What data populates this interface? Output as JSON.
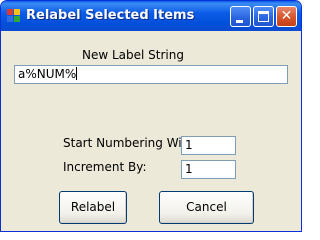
{
  "window": {
    "title": "Relabel Selected Items",
    "controls": {
      "minimize": "minimize",
      "maximize": "maximize",
      "close": "close"
    }
  },
  "form": {
    "label_string_title": "New Label String",
    "label_string_value": "a%NUM%",
    "start_label": "Start Numbering With:",
    "start_value": "1",
    "increment_label": "Increment By:",
    "increment_value": "1"
  },
  "buttons": {
    "relabel": "Relabel",
    "cancel": "Cancel"
  },
  "colors": {
    "titlebar": "#0a5ae6",
    "dialog_bg": "#ece9d8",
    "close_button": "#d9542b"
  }
}
